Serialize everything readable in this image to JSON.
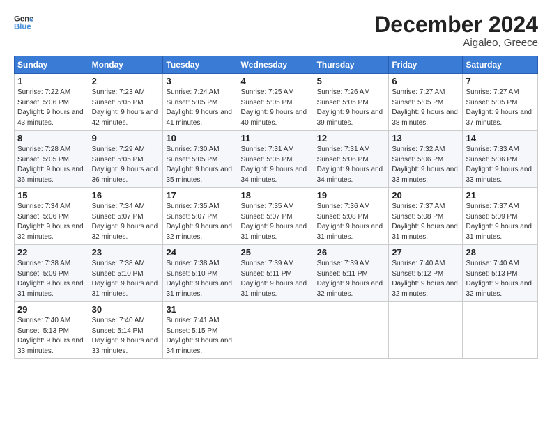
{
  "header": {
    "logo_line1": "General",
    "logo_line2": "Blue",
    "month_title": "December 2024",
    "location": "Aigaleo, Greece"
  },
  "days_of_week": [
    "Sunday",
    "Monday",
    "Tuesday",
    "Wednesday",
    "Thursday",
    "Friday",
    "Saturday"
  ],
  "weeks": [
    [
      {
        "day": "1",
        "sunrise": "7:22 AM",
        "sunset": "5:06 PM",
        "daylight": "9 hours and 43 minutes."
      },
      {
        "day": "2",
        "sunrise": "7:23 AM",
        "sunset": "5:05 PM",
        "daylight": "9 hours and 42 minutes."
      },
      {
        "day": "3",
        "sunrise": "7:24 AM",
        "sunset": "5:05 PM",
        "daylight": "9 hours and 41 minutes."
      },
      {
        "day": "4",
        "sunrise": "7:25 AM",
        "sunset": "5:05 PM",
        "daylight": "9 hours and 40 minutes."
      },
      {
        "day": "5",
        "sunrise": "7:26 AM",
        "sunset": "5:05 PM",
        "daylight": "9 hours and 39 minutes."
      },
      {
        "day": "6",
        "sunrise": "7:27 AM",
        "sunset": "5:05 PM",
        "daylight": "9 hours and 38 minutes."
      },
      {
        "day": "7",
        "sunrise": "7:27 AM",
        "sunset": "5:05 PM",
        "daylight": "9 hours and 37 minutes."
      }
    ],
    [
      {
        "day": "8",
        "sunrise": "7:28 AM",
        "sunset": "5:05 PM",
        "daylight": "9 hours and 36 minutes."
      },
      {
        "day": "9",
        "sunrise": "7:29 AM",
        "sunset": "5:05 PM",
        "daylight": "9 hours and 36 minutes."
      },
      {
        "day": "10",
        "sunrise": "7:30 AM",
        "sunset": "5:05 PM",
        "daylight": "9 hours and 35 minutes."
      },
      {
        "day": "11",
        "sunrise": "7:31 AM",
        "sunset": "5:05 PM",
        "daylight": "9 hours and 34 minutes."
      },
      {
        "day": "12",
        "sunrise": "7:31 AM",
        "sunset": "5:06 PM",
        "daylight": "9 hours and 34 minutes."
      },
      {
        "day": "13",
        "sunrise": "7:32 AM",
        "sunset": "5:06 PM",
        "daylight": "9 hours and 33 minutes."
      },
      {
        "day": "14",
        "sunrise": "7:33 AM",
        "sunset": "5:06 PM",
        "daylight": "9 hours and 33 minutes."
      }
    ],
    [
      {
        "day": "15",
        "sunrise": "7:34 AM",
        "sunset": "5:06 PM",
        "daylight": "9 hours and 32 minutes."
      },
      {
        "day": "16",
        "sunrise": "7:34 AM",
        "sunset": "5:07 PM",
        "daylight": "9 hours and 32 minutes."
      },
      {
        "day": "17",
        "sunrise": "7:35 AM",
        "sunset": "5:07 PM",
        "daylight": "9 hours and 32 minutes."
      },
      {
        "day": "18",
        "sunrise": "7:35 AM",
        "sunset": "5:07 PM",
        "daylight": "9 hours and 31 minutes."
      },
      {
        "day": "19",
        "sunrise": "7:36 AM",
        "sunset": "5:08 PM",
        "daylight": "9 hours and 31 minutes."
      },
      {
        "day": "20",
        "sunrise": "7:37 AM",
        "sunset": "5:08 PM",
        "daylight": "9 hours and 31 minutes."
      },
      {
        "day": "21",
        "sunrise": "7:37 AM",
        "sunset": "5:09 PM",
        "daylight": "9 hours and 31 minutes."
      }
    ],
    [
      {
        "day": "22",
        "sunrise": "7:38 AM",
        "sunset": "5:09 PM",
        "daylight": "9 hours and 31 minutes."
      },
      {
        "day": "23",
        "sunrise": "7:38 AM",
        "sunset": "5:10 PM",
        "daylight": "9 hours and 31 minutes."
      },
      {
        "day": "24",
        "sunrise": "7:38 AM",
        "sunset": "5:10 PM",
        "daylight": "9 hours and 31 minutes."
      },
      {
        "day": "25",
        "sunrise": "7:39 AM",
        "sunset": "5:11 PM",
        "daylight": "9 hours and 31 minutes."
      },
      {
        "day": "26",
        "sunrise": "7:39 AM",
        "sunset": "5:11 PM",
        "daylight": "9 hours and 32 minutes."
      },
      {
        "day": "27",
        "sunrise": "7:40 AM",
        "sunset": "5:12 PM",
        "daylight": "9 hours and 32 minutes."
      },
      {
        "day": "28",
        "sunrise": "7:40 AM",
        "sunset": "5:13 PM",
        "daylight": "9 hours and 32 minutes."
      }
    ],
    [
      {
        "day": "29",
        "sunrise": "7:40 AM",
        "sunset": "5:13 PM",
        "daylight": "9 hours and 33 minutes."
      },
      {
        "day": "30",
        "sunrise": "7:40 AM",
        "sunset": "5:14 PM",
        "daylight": "9 hours and 33 minutes."
      },
      {
        "day": "31",
        "sunrise": "7:41 AM",
        "sunset": "5:15 PM",
        "daylight": "9 hours and 34 minutes."
      },
      null,
      null,
      null,
      null
    ]
  ]
}
